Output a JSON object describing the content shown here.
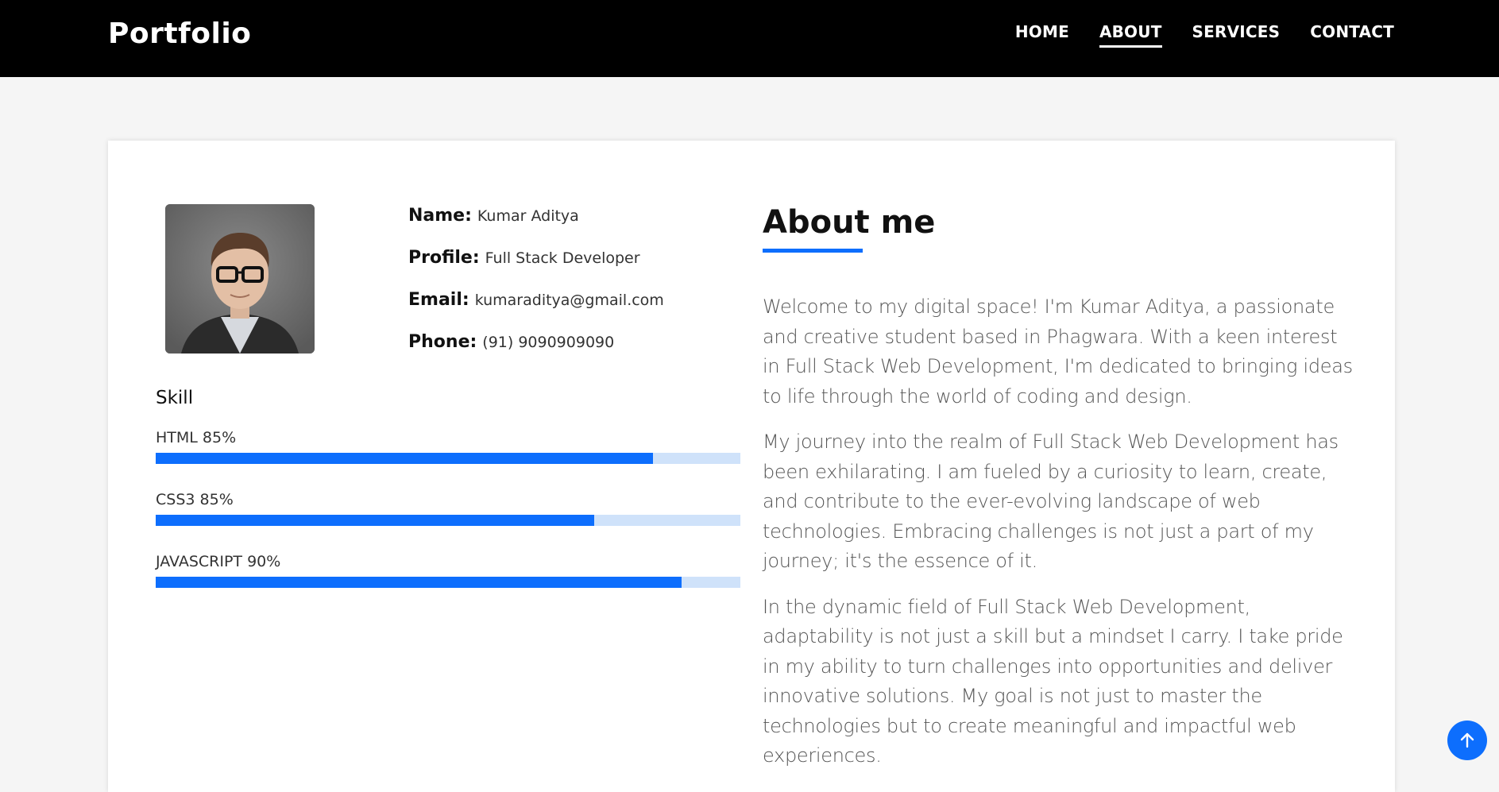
{
  "nav": {
    "brand": "Portfolio",
    "links": [
      {
        "label": "HOME"
      },
      {
        "label": "ABOUT",
        "active": true
      },
      {
        "label": "SERVICES"
      },
      {
        "label": "CONTACT"
      }
    ]
  },
  "profile": {
    "name_label": "Name:",
    "name": "Kumar Aditya",
    "profile_label": "Profile:",
    "profile": "Full Stack Developer",
    "email_label": "Email:",
    "email": "kumaraditya@gmail.com",
    "phone_label": "Phone:",
    "phone": "(91) 9090909090"
  },
  "skills": {
    "title": "Skill",
    "items": [
      {
        "label": "HTML 85%",
        "fill": 0.85
      },
      {
        "label": "CSS3 85%",
        "fill": 0.75
      },
      {
        "label": "JAVASCRIPT 90%",
        "fill": 0.9
      }
    ]
  },
  "about": {
    "title": "About me",
    "paragraphs": [
      "Welcome to my digital space! I'm Kumar Aditya, a passionate and creative student based in Phagwara. With a keen interest in Full Stack Web Development, I'm dedicated to bringing ideas to life through the world of coding and design.",
      "My journey into the realm of Full Stack Web Development has been exhilarating. I am fueled by a curiosity to learn, create, and contribute to the ever-evolving landscape of web technologies. Embracing challenges is not just a part of my journey; it's the essence of it.",
      "In the dynamic field of Full Stack Web Development, adaptability is not just a skill but a mindset I carry. I take pride in my ability to turn challenges into opportunities and deliver innovative solutions. My goal is not just to master the technologies but to create meaningful and impactful web experiences."
    ]
  },
  "colors": {
    "accent": "#0d6efd",
    "track": "#cfe2fa",
    "navbar": "#000000"
  },
  "icons": {
    "scroll_top": "arrow-up-icon"
  }
}
